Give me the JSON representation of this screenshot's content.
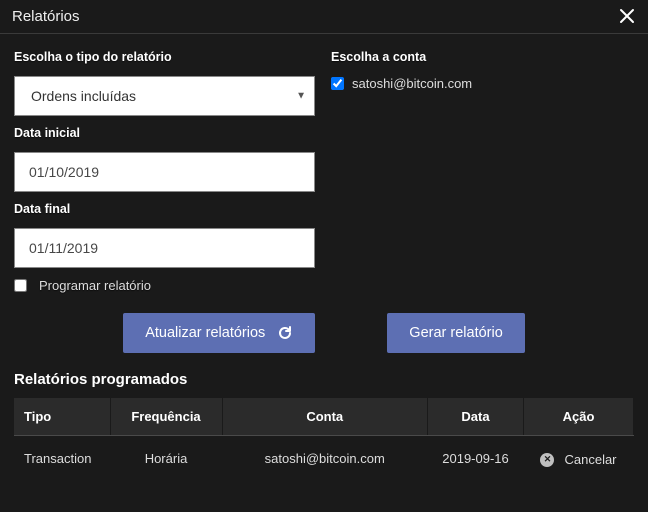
{
  "title": "Relatórios",
  "form": {
    "type_label": "Escolha o tipo do relatório",
    "type_value": "Ordens incluídas",
    "account_label": "Escolha a conta",
    "account_value": "satoshi@bitcoin.com",
    "start_date_label": "Data inicial",
    "start_date_value": "01/10/2019",
    "end_date_label": "Data final",
    "end_date_value": "01/11/2019",
    "schedule_label": "Programar relatório"
  },
  "buttons": {
    "refresh": "Atualizar relatórios",
    "generate": "Gerar relatório"
  },
  "scheduled": {
    "title": "Relatórios programados",
    "headers": {
      "type": "Tipo",
      "freq": "Frequência",
      "account": "Conta",
      "date": "Data",
      "action": "Ação"
    },
    "rows": [
      {
        "type": "Transaction",
        "freq": "Horária",
        "account": "satoshi@bitcoin.com",
        "date": "2019-09-16",
        "action": "Cancelar"
      }
    ]
  }
}
